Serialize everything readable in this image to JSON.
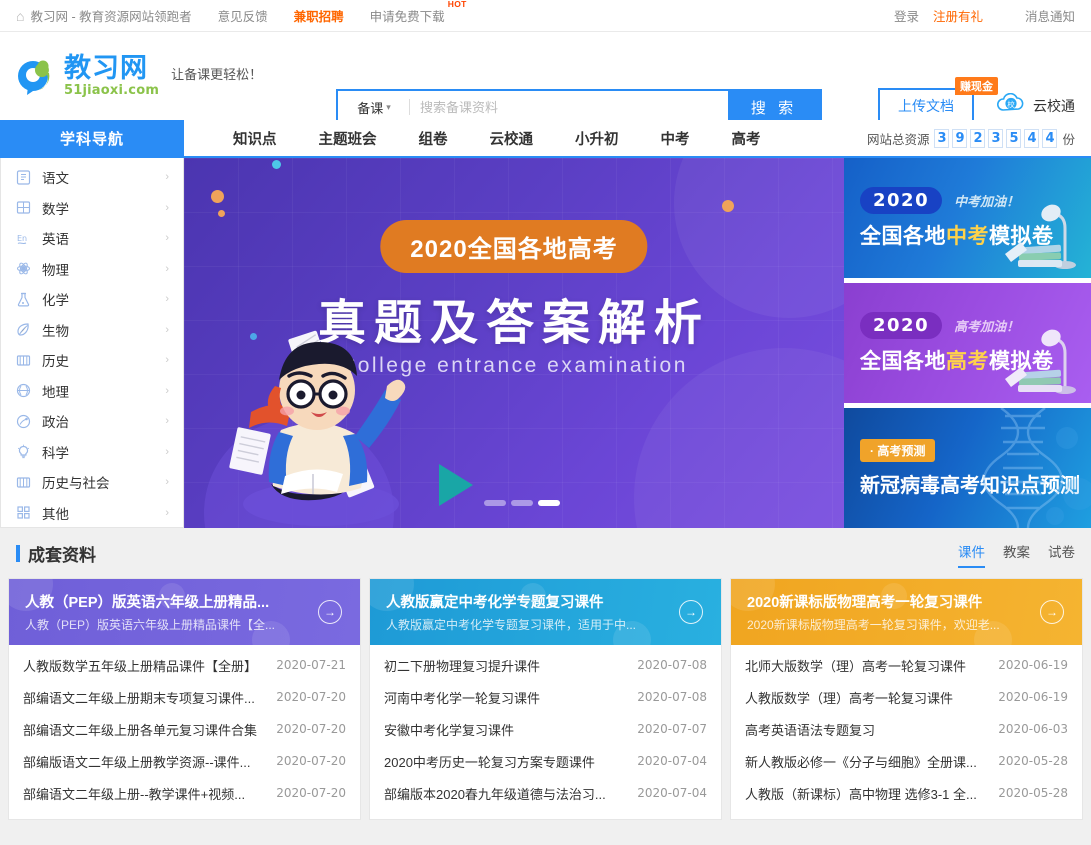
{
  "topbar": {
    "home_icon": "home-icon",
    "site_name": "教习网 - 教育资源网站领跑者",
    "links": [
      {
        "label": "意见反馈",
        "style": "normal"
      },
      {
        "label": "兼职招聘",
        "style": "orange"
      },
      {
        "label": "申请免费下载",
        "style": "hot",
        "badge": "HOT"
      }
    ],
    "right": [
      {
        "label": "登录",
        "style": "normal"
      },
      {
        "label": "注册有礼",
        "style": "orange"
      },
      {
        "label": "消息通知",
        "style": "normal"
      }
    ]
  },
  "header": {
    "logo_cn": "教习网",
    "logo_en": "51jiaoxi.com",
    "slogan": "让备课更轻松！",
    "search": {
      "category": "备课",
      "placeholder": "搜索备课资料",
      "value": "",
      "button": "搜 索"
    },
    "upload": {
      "label": "上传文档",
      "badge": "赚现金"
    },
    "cloud": {
      "label": "云校通",
      "icon_text": "校"
    }
  },
  "nav": {
    "subject_nav": "学科导航",
    "items": [
      {
        "label": "知识点"
      },
      {
        "label": "主题班会"
      },
      {
        "label": "组卷"
      },
      {
        "label": "云校通"
      },
      {
        "label": "小升初"
      },
      {
        "label": "中考"
      },
      {
        "label": "高考"
      }
    ],
    "resource_total_label": "网站总资源",
    "resource_total_digits": [
      "3",
      "9",
      "2",
      "3",
      "5",
      "4",
      "4"
    ],
    "resource_total_unit": "份"
  },
  "subjects": [
    {
      "label": "语文",
      "icon": "book-icon"
    },
    {
      "label": "数学",
      "icon": "grid-math-icon"
    },
    {
      "label": "英语",
      "icon": "english-icon"
    },
    {
      "label": "物理",
      "icon": "atom-icon"
    },
    {
      "label": "化学",
      "icon": "flask-icon"
    },
    {
      "label": "生物",
      "icon": "leaf-icon"
    },
    {
      "label": "历史",
      "icon": "scroll-icon"
    },
    {
      "label": "地理",
      "icon": "globe-icon"
    },
    {
      "label": "政治",
      "icon": "balance-icon"
    },
    {
      "label": "科学",
      "icon": "bulb-icon"
    },
    {
      "label": "历史与社会",
      "icon": "book-open-icon"
    },
    {
      "label": "其他",
      "icon": "squares-icon"
    }
  ],
  "banner": {
    "pill": "2020全国各地高考",
    "main": "真题及答案解析",
    "sub": "College entrance examination",
    "dots": 3,
    "active_dot": 3
  },
  "promos": [
    {
      "year": "2020",
      "cheer": "中考加油！",
      "main_before": "全国各地",
      "main_highlight": "中考",
      "main_after": "模拟卷",
      "theme": "promo-1"
    },
    {
      "year": "2020",
      "cheer": "高考加油！",
      "main_before": "全国各地",
      "main_highlight": "高考",
      "main_after": "模拟卷",
      "theme": "promo-2"
    },
    {
      "tag": "· 高考预测",
      "main": "新冠病毒高考知识点预测",
      "theme": "promo-3"
    }
  ],
  "section": {
    "title": "成套资料",
    "tabs": [
      {
        "label": "课件",
        "active": true
      },
      {
        "label": "教案",
        "active": false
      },
      {
        "label": "试卷",
        "active": false
      }
    ]
  },
  "cards": [
    {
      "theme": "c-purple",
      "title": "人教（PEP）版英语六年级上册精品...",
      "desc": "人教（PEP）版英语六年级上册精品课件【全...",
      "arrow_icon": "arrow-right-circle-icon",
      "items": [
        {
          "title": "人教版数学五年级上册精品课件【全册】",
          "date": "2020-07-21"
        },
        {
          "title": "部编语文二年级上册期末专项复习课件...",
          "date": "2020-07-20"
        },
        {
          "title": "部编语文二年级上册各单元复习课件合集",
          "date": "2020-07-20"
        },
        {
          "title": "部编版语文二年级上册教学资源--课件...",
          "date": "2020-07-20"
        },
        {
          "title": "部编语文二年级上册--教学课件+视频...",
          "date": "2020-07-20"
        }
      ]
    },
    {
      "theme": "c-blue",
      "title": "人教版赢定中考化学专题复习课件",
      "desc": "人教版赢定中考化学专题复习课件，适用于中...",
      "arrow_icon": "arrow-right-circle-icon",
      "items": [
        {
          "title": "初二下册物理复习提升课件",
          "date": "2020-07-08"
        },
        {
          "title": "河南中考化学一轮复习课件",
          "date": "2020-07-08"
        },
        {
          "title": "安徽中考化学复习课件",
          "date": "2020-07-07"
        },
        {
          "title": "2020中考历史一轮复习方案专题课件",
          "date": "2020-07-04"
        },
        {
          "title": "部编版本2020春九年级道德与法治习...",
          "date": "2020-07-04"
        }
      ]
    },
    {
      "theme": "c-orange",
      "title": "2020新课标版物理高考一轮复习课件",
      "desc": "2020新课标版物理高考一轮复习课件，欢迎老...",
      "arrow_icon": "arrow-right-circle-icon",
      "items": [
        {
          "title": "北师大版数学（理）高考一轮复习课件",
          "date": "2020-06-19"
        },
        {
          "title": "人教版数学（理）高考一轮复习课件",
          "date": "2020-06-19"
        },
        {
          "title": "高考英语语法专题复习",
          "date": "2020-06-03"
        },
        {
          "title": "新人教版必修一《分子与细胞》全册课...",
          "date": "2020-05-28"
        },
        {
          "title": "人教版（新课标）高中物理 选修3-1 全...",
          "date": "2020-05-28"
        }
      ]
    }
  ],
  "colors": {
    "primary": "#2a8cf5",
    "orange": "#ff6600",
    "banner_purple": "#5b3fc4",
    "card_purple": "#6f5fd8",
    "card_blue": "#1e9ad6",
    "card_orange": "#f0a520"
  }
}
